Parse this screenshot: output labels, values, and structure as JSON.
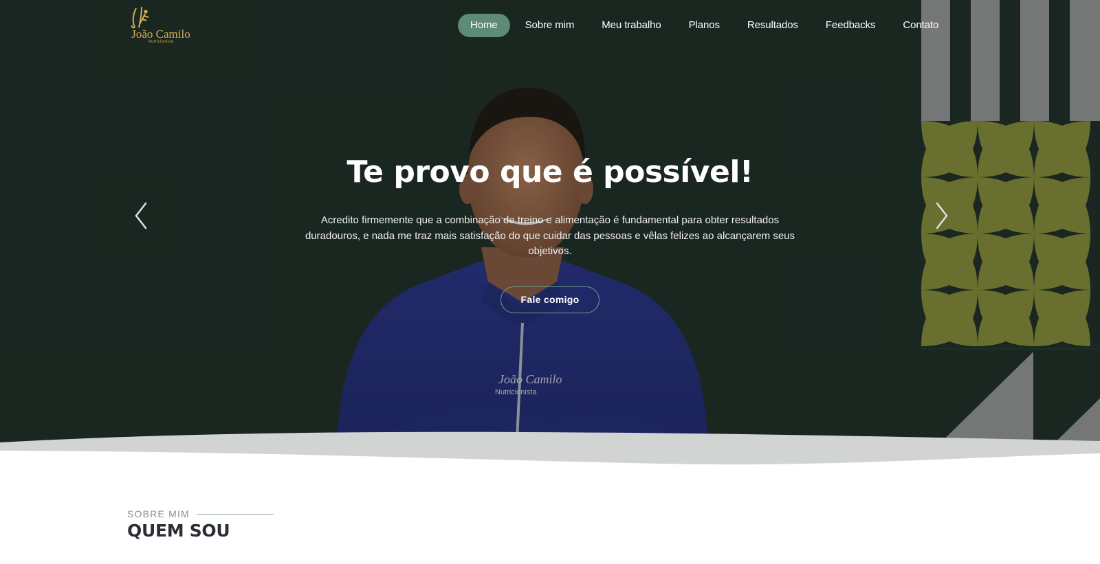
{
  "brand": {
    "name": "João Camilo",
    "tagline": "Nutricionista",
    "color": "#d3ad57"
  },
  "nav": {
    "items": [
      {
        "label": "Home",
        "active": true
      },
      {
        "label": "Sobre mim",
        "active": false
      },
      {
        "label": "Meu trabalho",
        "active": false
      },
      {
        "label": "Planos",
        "active": false
      },
      {
        "label": "Resultados",
        "active": false
      },
      {
        "label": "Feedbacks",
        "active": false
      },
      {
        "label": "Contato",
        "active": false
      }
    ],
    "active_color": "#5e8a78"
  },
  "hero": {
    "title": "Te provo que é possível!",
    "text": "Acredito firmemente que a combinação de treino e alimentação é fundamental para obter resultados duradouros, e nada me traz mais satisfação do que cuidar das pessoas e vêlas felizes ao alcançarem seus objetivos.",
    "cta_label": "Fale comigo",
    "background": "#1c2b25",
    "prev_icon": "chevron-left-icon",
    "next_icon": "chevron-right-icon",
    "photo_shirt_text": "João Camilo",
    "photo_shirt_subtext": "Nutricionista"
  },
  "section": {
    "eyebrow": "SOBRE MIM",
    "title": "QUEM SOU"
  },
  "colors": {
    "pattern_green": "#8a8f36",
    "pattern_gray": "#9a9a9a"
  }
}
